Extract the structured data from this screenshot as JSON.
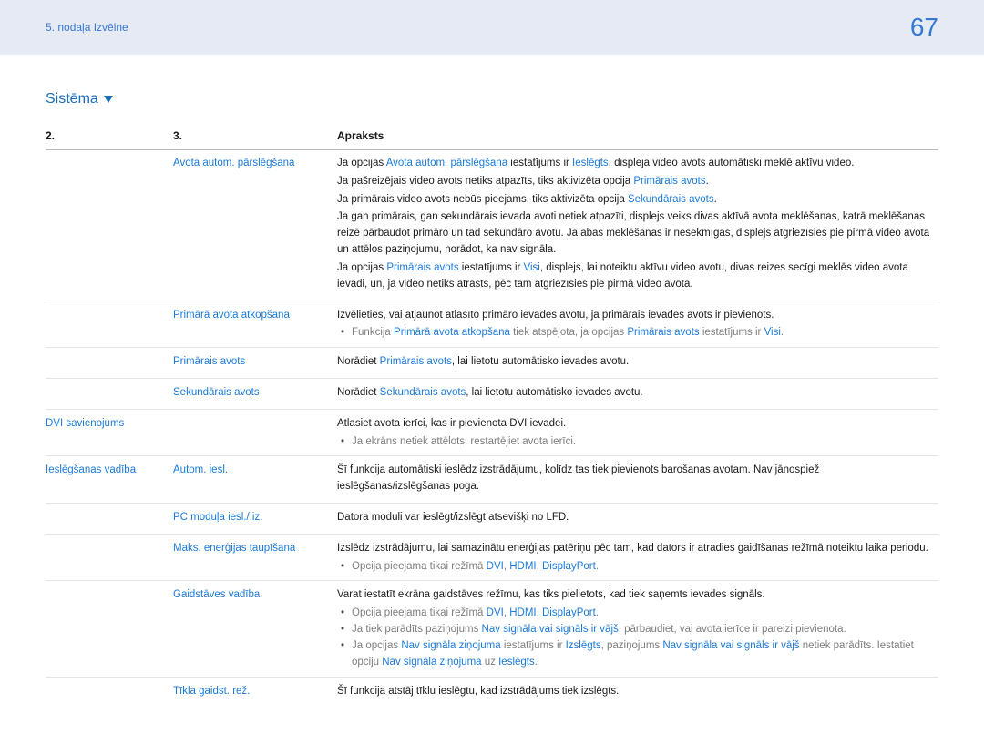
{
  "header": {
    "chapter": "5. nodaļa Izvēlne",
    "page": "67"
  },
  "section": {
    "title": "Sistēma"
  },
  "table": {
    "headers": {
      "c1": "2.",
      "c2": "3.",
      "c3": "Apraksts"
    },
    "rows": {
      "r1": {
        "c2": "Avota autom. pārslēgšana",
        "p1a": "Ja opcijas ",
        "p1b": "Avota autom. pārslēgšana",
        "p1c": " iestatījums ir ",
        "p1d": "Ieslēgts",
        "p1e": ", displeja video avots automātiski meklē aktīvu video.",
        "p2a": "Ja pašreizējais video avots netiks atpazīts, tiks aktivizēta opcija ",
        "p2b": "Primārais avots",
        "p2c": ".",
        "p3a": "Ja primārais video avots nebūs pieejams, tiks aktivizēta opcija ",
        "p3b": "Sekundārais avots",
        "p3c": ".",
        "p4": "Ja gan primārais, gan sekundārais ievada avoti netiek atpazīti, displejs veiks divas aktīvā avota meklēšanas, katrā meklēšanas reizē pārbaudot primāro un tad sekundāro avotu. Ja abas meklēšanas ir nesekmīgas, displejs atgriezīsies pie pirmā video avota un attēlos paziņojumu, norādot, ka nav signāla.",
        "p5a": "Ja opcijas ",
        "p5b": "Primārais avots",
        "p5c": " iestatījums ir ",
        "p5d": "Visi",
        "p5e": ", displejs, lai noteiktu aktīvu video avotu, divas reizes secīgi meklēs video avota ievadi, un, ja video netiks atrasts, pēc tam atgriezīsies pie pirmā video avota."
      },
      "r2": {
        "c2": "Primārā avota atkopšana",
        "p1": "Izvēlieties, vai atjaunot atlasīto primāro ievades avotu, ja primārais ievades avots ir pievienots.",
        "b1a": "Funkcija ",
        "b1b": "Primārā avota atkopšana",
        "b1c": " tiek atspējota, ja opcijas ",
        "b1d": "Primārais avots",
        "b1e": " iestatījums ir ",
        "b1f": "Visi",
        "b1g": "."
      },
      "r3": {
        "c2": "Primārais avots",
        "p1a": "Norādiet ",
        "p1b": "Primārais avots",
        "p1c": ", lai lietotu automātisko ievades avotu."
      },
      "r4": {
        "c2": "Sekundārais avots",
        "p1a": "Norādiet ",
        "p1b": "Sekundārais avots",
        "p1c": ", lai lietotu automātisko ievades avotu."
      },
      "r5": {
        "c1": "DVI savienojums",
        "p1": "Atlasiet avota ierīci, kas ir pievienota DVI ievadei.",
        "b1": "Ja ekrāns netiek attēlots, restartējiet avota ierīci."
      },
      "r6": {
        "c1": "Ieslēgšanas vadība",
        "c2": "Autom. iesl.",
        "p1": "Šī funkcija automātiski ieslēdz izstrādājumu, kolīdz tas tiek pievienots barošanas avotam. Nav jānospiež ieslēgšanas/izslēgšanas poga."
      },
      "r7": {
        "c2": "PC moduļa iesl./.iz.",
        "p1": "Datora moduli var ieslēgt/izslēgt atsevišķi no LFD."
      },
      "r8": {
        "c2": "Maks. enerģijas taupīšana",
        "p1": "Izslēdz izstrādājumu, lai samazinātu enerģijas patēriņu pēc tam, kad dators ir atradies gaidīšanas režīmā noteiktu laika periodu.",
        "b1a": "Opcija pieejama tikai režīmā ",
        "b1b": "DVI",
        "b1c": ", ",
        "b1d": "HDMI",
        "b1e": ", ",
        "b1f": "DisplayPort",
        "b1g": "."
      },
      "r9": {
        "c2": "Gaidstāves vadība",
        "p1": "Varat iestatīt ekrāna gaidstāves režīmu, kas tiks pielietots, kad tiek saņemts ievades signāls.",
        "b1a": "Opcija pieejama tikai režīmā ",
        "b1b": "DVI",
        "b1c": ", ",
        "b1d": "HDMI",
        "b1e": ", ",
        "b1f": "DisplayPort",
        "b1g": ".",
        "b2a": "Ja tiek parādīts paziņojums ",
        "b2b": "Nav signāla vai signāls ir vājš",
        "b2c": ", pārbaudiet, vai avota ierīce ir pareizi pievienota.",
        "b3a": "Ja opcijas ",
        "b3b": "Nav signāla ziņojuma",
        "b3c": " iestatījums ir ",
        "b3d": "Izslēgts",
        "b3e": ", paziņojums ",
        "b3f": "Nav signāla vai signāls ir vājš",
        "b3g": " netiek parādīts. Iestatiet opciju ",
        "b3h": "Nav signāla ziņojuma",
        "b3i": " uz ",
        "b3j": "Ieslēgts",
        "b3k": "."
      },
      "r10": {
        "c2": "Tīkla gaidst. rež.",
        "p1": "Šī funkcija atstāj tīklu ieslēgtu, kad izstrādājums tiek izslēgts."
      }
    }
  }
}
